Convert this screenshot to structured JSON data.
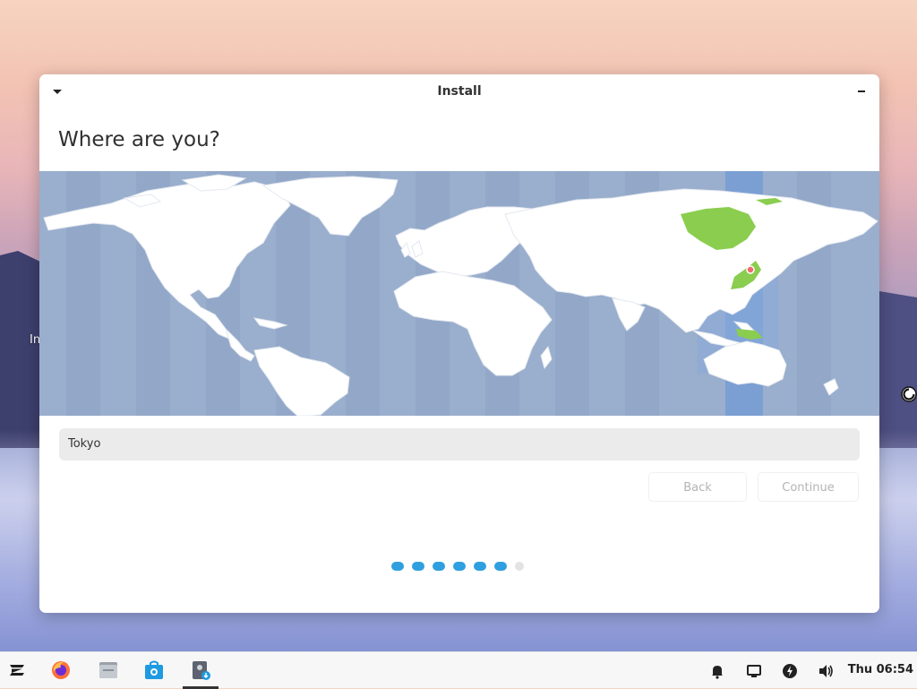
{
  "desktop": {
    "partial_label": "In"
  },
  "window": {
    "title": "Install",
    "heading": "Where are you?",
    "timezone_value": "Tokyo",
    "back_label": "Back",
    "continue_label": "Continue",
    "progress": {
      "completed_steps": 6,
      "total_steps": 7
    }
  },
  "taskbar": {
    "apps": [
      "zorin-menu-icon",
      "firefox-icon",
      "files-icon",
      "software-icon",
      "installer-icon"
    ],
    "tray_icons": [
      "bell-icon",
      "display-icon",
      "power-icon",
      "volume-icon"
    ],
    "clock": "Thu 06:54"
  },
  "colors": {
    "accent": "#2f9fdf",
    "map_ocean": "#9aaecd",
    "selected_zone": "#7db1e6",
    "selected_region": "#8acd4f"
  }
}
